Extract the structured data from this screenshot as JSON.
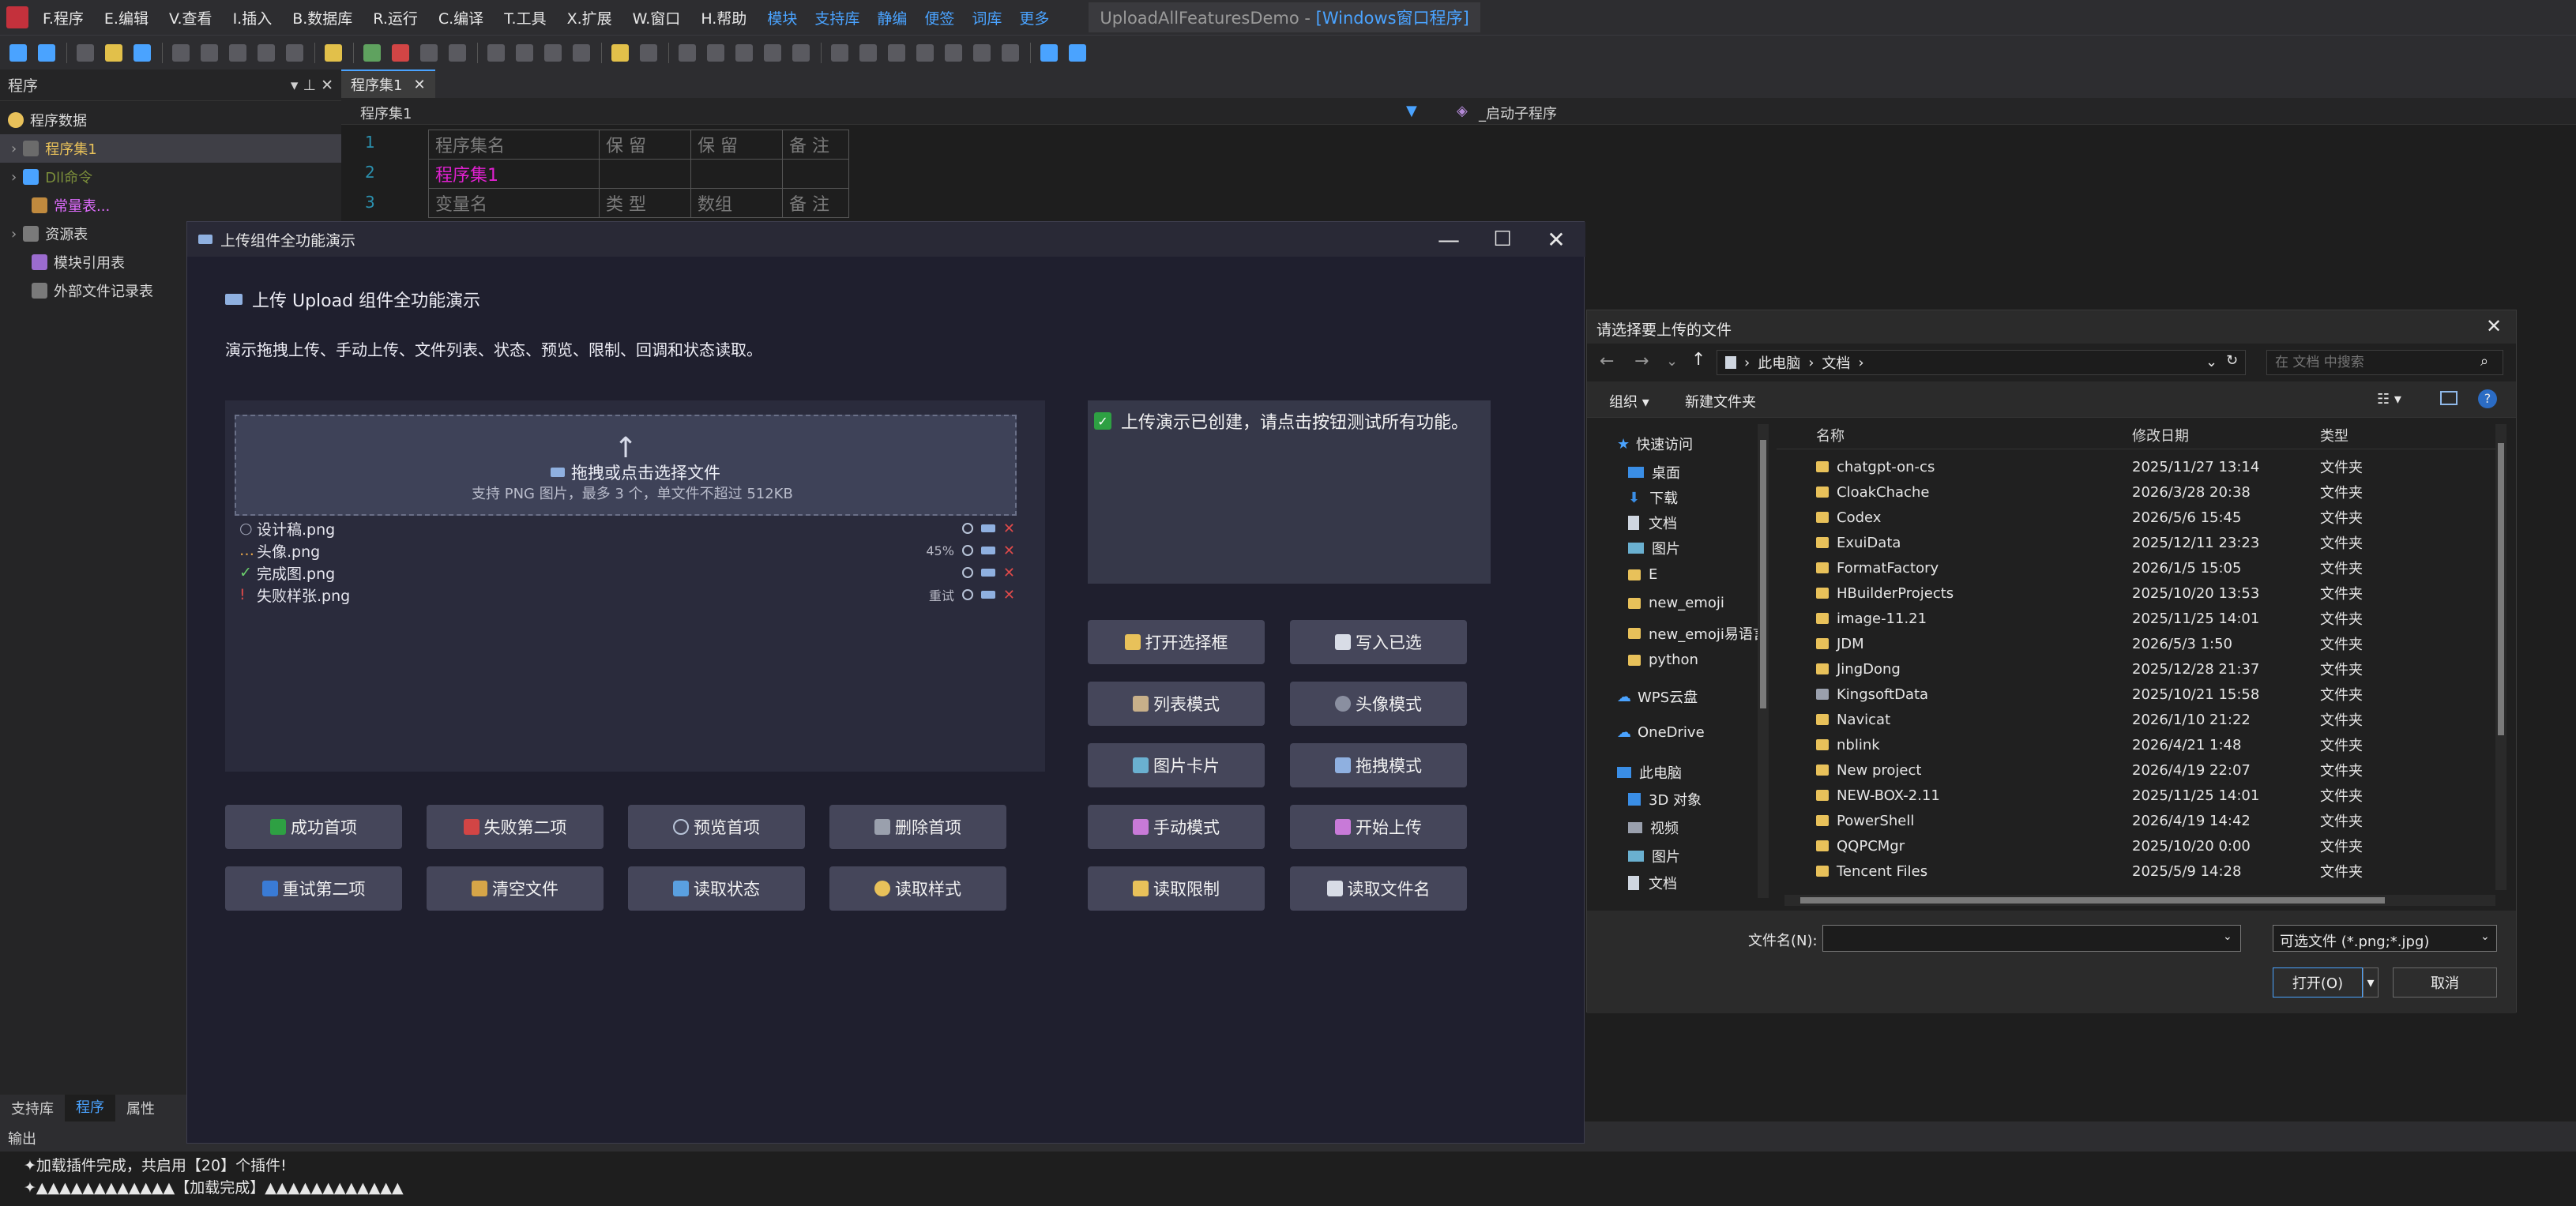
{
  "menubar": {
    "items": [
      "F.程序",
      "E.编辑",
      "V.查看",
      "I.插入",
      "B.数据库",
      "R.运行",
      "C.编译",
      "T.工具",
      "X.扩展",
      "W.窗口",
      "H.帮助"
    ],
    "links": [
      "模块",
      "支持库",
      "静编",
      "便签",
      "词库",
      "更多"
    ],
    "title": "UploadAllFeaturesDemo - ",
    "title_accent": "[Windows窗口程序]"
  },
  "leftpanel": {
    "title": "程序",
    "pin": "▾ ⊥ ✕",
    "root": "程序数据",
    "items": [
      "程序集1",
      "Dll命令",
      "常量表...",
      "资源表",
      "模块引用表",
      "外部文件记录表"
    ],
    "tabs": [
      "支持库",
      "程序",
      "属性"
    ]
  },
  "editor": {
    "tab": "程序集1",
    "nav_left": "程序集1",
    "nav_right": "_启动子程序",
    "lines": [
      "1",
      "2",
      "3"
    ],
    "row1": [
      "程序集名",
      "保 留",
      "保 留",
      "备 注"
    ],
    "row2": "程序集1",
    "row3": [
      "变量名",
      "类 型",
      "数组",
      "备 注"
    ]
  },
  "output": {
    "title": "输出",
    "lines": [
      "✦加载插件完成，共启用【20】个插件!",
      "✦▲▲▲▲▲▲▲▲▲▲▲▲【加载完成】▲▲▲▲▲▲▲▲▲▲▲▲"
    ]
  },
  "demo": {
    "title": "上传组件全功能演示",
    "heading": "上传 Upload 组件全功能演示",
    "desc": "演示拖拽上传、手动上传、文件列表、状态、预览、限制、回调和状态读取。",
    "drop_title": "拖拽或点击选择文件",
    "drop_hint": "支持 PNG 图片，最多 3 个，单文件不超过 512KB",
    "files": [
      {
        "mark": "○",
        "name": "设计稿.png",
        "extra": ""
      },
      {
        "mark": "…",
        "name": "头像.png",
        "extra": "45%"
      },
      {
        "mark": "✓",
        "name": "完成图.png",
        "extra": ""
      },
      {
        "mark": "!",
        "name": "失败样张.png",
        "extra": "重试"
      }
    ],
    "status": "上传演示已创建，请点击按钮测试所有功能。",
    "left_buttons": [
      "成功首项",
      "失败第二项",
      "预览首项",
      "删除首项",
      "重试第二项",
      "清空文件",
      "读取状态",
      "读取样式"
    ],
    "right_buttons": [
      "打开选择框",
      "写入已选",
      "列表模式",
      "头像模式",
      "图片卡片",
      "拖拽模式",
      "手动模式",
      "开始上传",
      "读取限制",
      "读取文件名"
    ]
  },
  "filedialog": {
    "title": "请选择要上传的文件",
    "path": [
      "此电脑",
      "文档"
    ],
    "search_placeholder": "在 文档 中搜索",
    "organize": "组织 ▾",
    "new_folder": "新建文件夹",
    "nav": [
      "快速访问",
      "桌面",
      "下载",
      "文档",
      "图片",
      "E",
      "new_emoji",
      "new_emoji易语言",
      "python",
      "WPS云盘",
      "OneDrive",
      "此电脑",
      "3D 对象",
      "视频",
      "图片",
      "文档"
    ],
    "columns": [
      "名称",
      "修改日期",
      "类型"
    ],
    "rows": [
      {
        "name": "chatgpt-on-cs",
        "date": "2025/11/27 13:14",
        "type": "文件夹"
      },
      {
        "name": "CloakChache",
        "date": "2026/3/28 20:38",
        "type": "文件夹"
      },
      {
        "name": "Codex",
        "date": "2026/5/6 15:45",
        "type": "文件夹"
      },
      {
        "name": "ExuiData",
        "date": "2025/12/11 23:23",
        "type": "文件夹"
      },
      {
        "name": "FormatFactory",
        "date": "2026/1/5 15:05",
        "type": "文件夹"
      },
      {
        "name": "HBuilderProjects",
        "date": "2025/10/20 13:53",
        "type": "文件夹"
      },
      {
        "name": "image-11.21",
        "date": "2025/11/25 14:01",
        "type": "文件夹"
      },
      {
        "name": "JDM",
        "date": "2026/5/3 1:50",
        "type": "文件夹"
      },
      {
        "name": "JingDong",
        "date": "2025/12/28 21:37",
        "type": "文件夹"
      },
      {
        "name": "KingsoftData",
        "date": "2025/10/21 15:58",
        "type": "文件夹"
      },
      {
        "name": "Navicat",
        "date": "2026/1/10 21:22",
        "type": "文件夹"
      },
      {
        "name": "nblink",
        "date": "2026/4/21 1:48",
        "type": "文件夹"
      },
      {
        "name": "New project",
        "date": "2026/4/19 22:07",
        "type": "文件夹"
      },
      {
        "name": "NEW-BOX-2.11",
        "date": "2025/11/25 14:01",
        "type": "文件夹"
      },
      {
        "name": "PowerShell",
        "date": "2026/4/19 14:42",
        "type": "文件夹"
      },
      {
        "name": "QQPCMgr",
        "date": "2025/10/20 0:00",
        "type": "文件夹"
      },
      {
        "name": "Tencent Files",
        "date": "2025/5/9 14:28",
        "type": "文件夹"
      }
    ],
    "filename_label": "文件名(N):",
    "filename_value": "",
    "filter": "可选文件 (*.png;*.jpg)",
    "open": "打开(O)",
    "cancel": "取消"
  }
}
